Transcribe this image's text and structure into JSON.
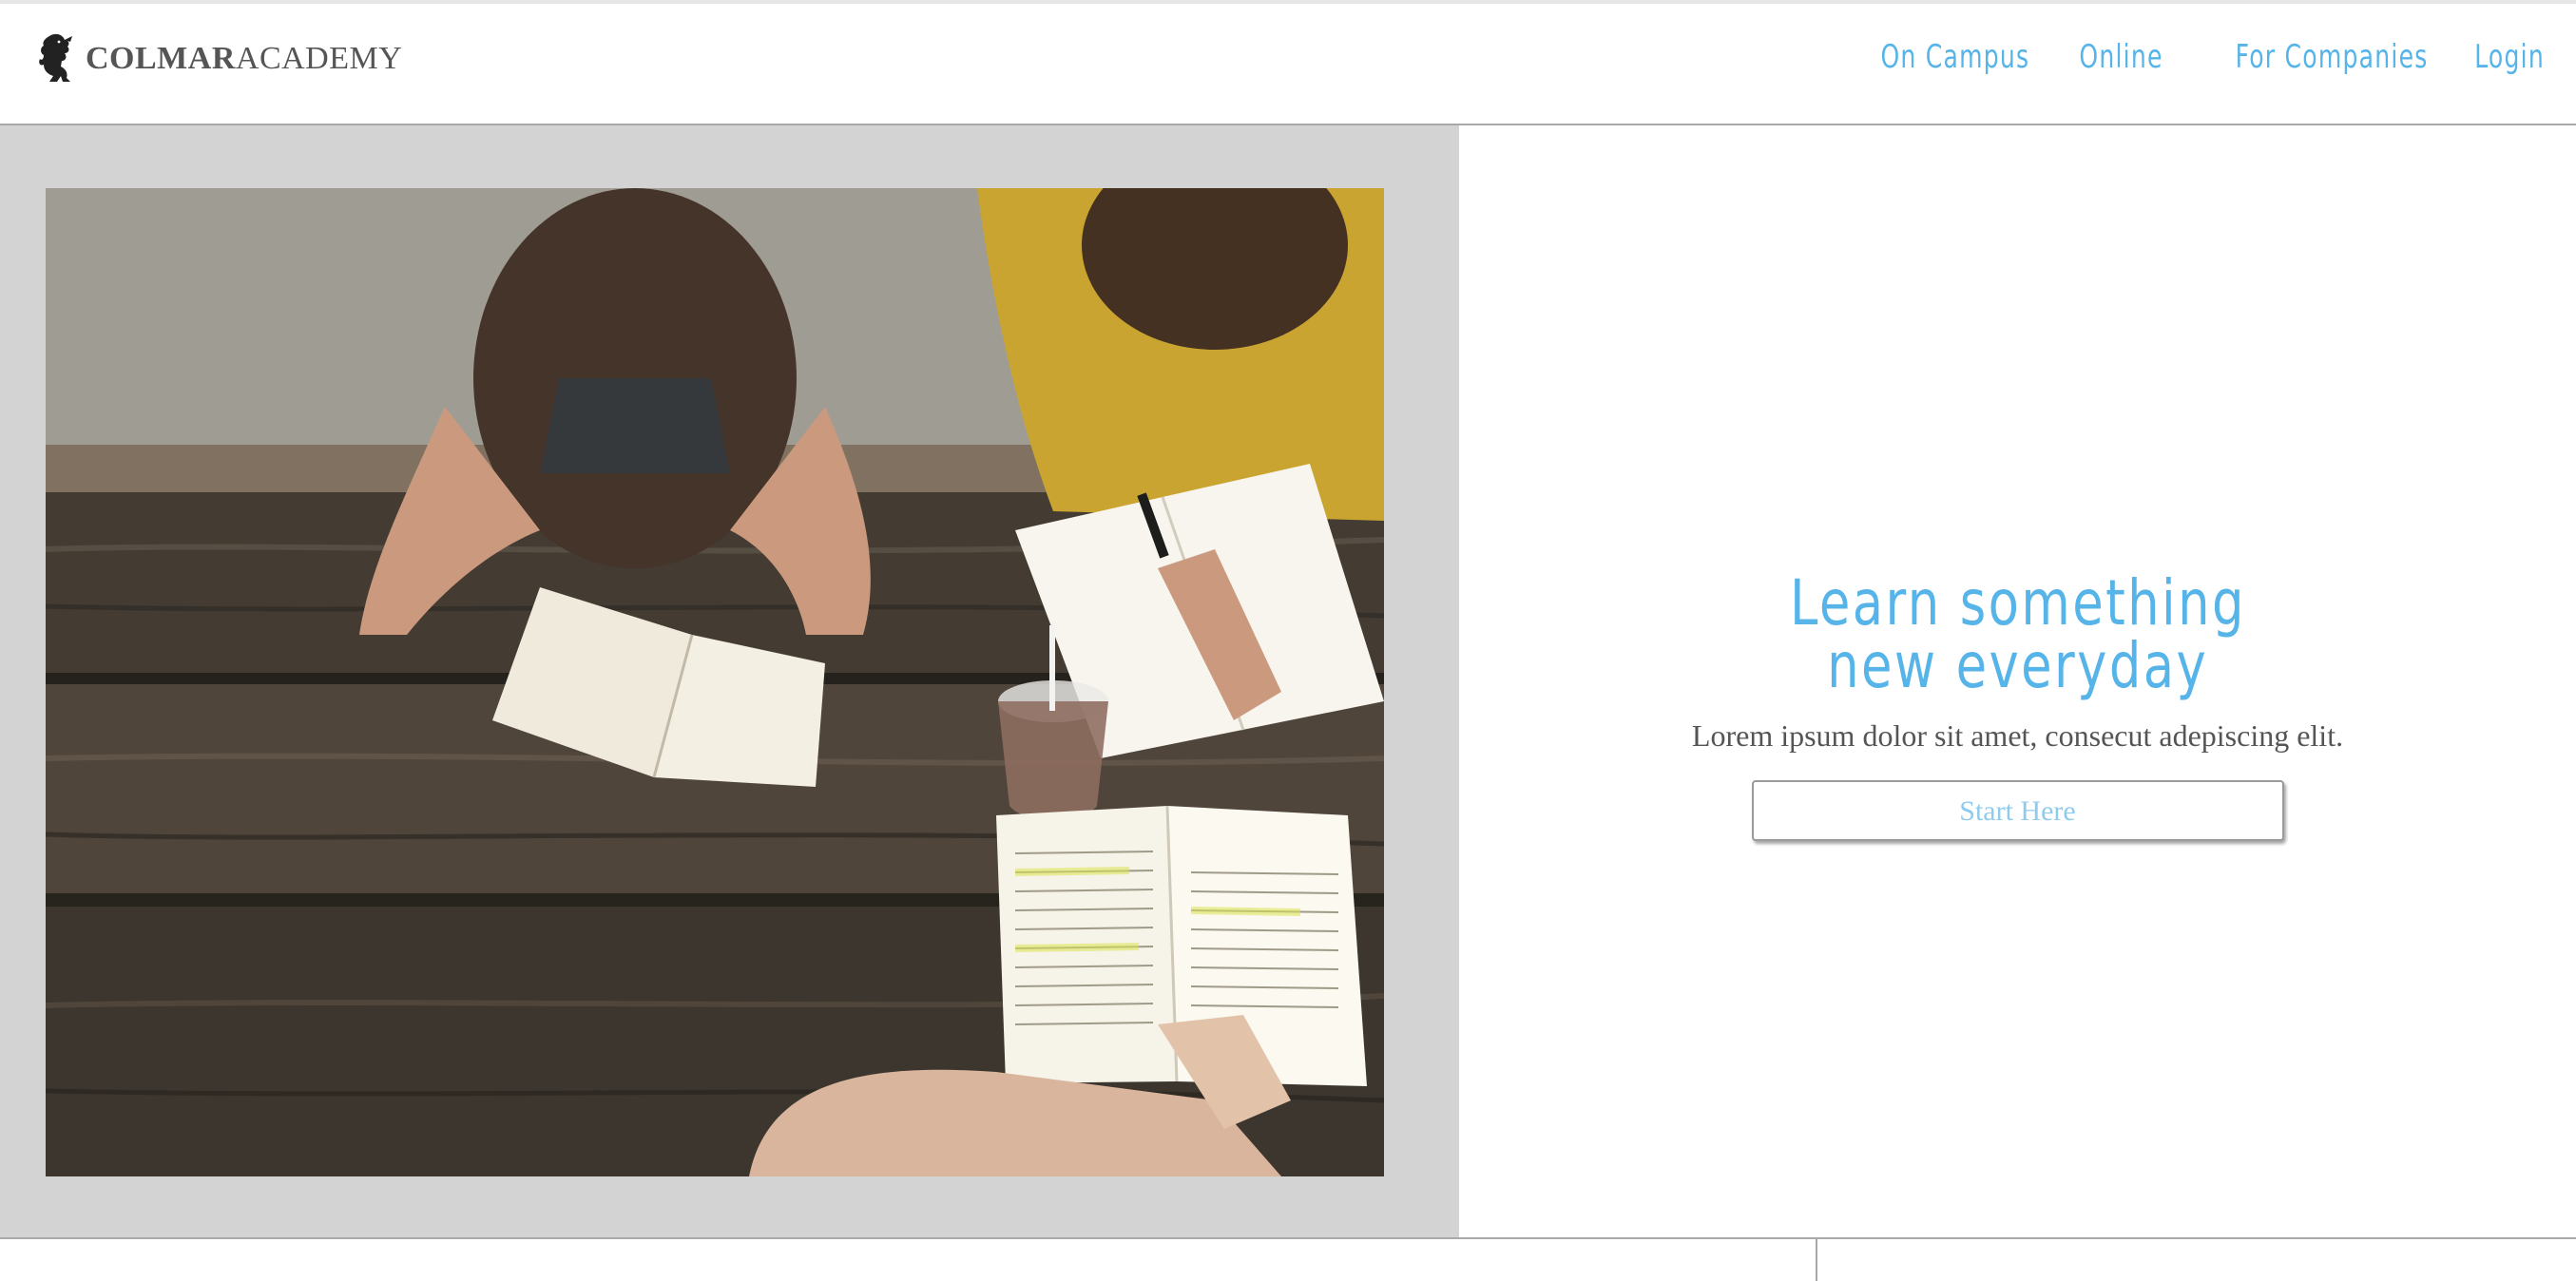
{
  "header": {
    "logo": {
      "bold_text": "COLMAR",
      "light_text": "ACADEMY",
      "icon": "lion-rampant-icon"
    },
    "nav": [
      {
        "label": "On Campus"
      },
      {
        "label": "Online"
      },
      {
        "label": "For Companies"
      },
      {
        "label": "Login"
      }
    ]
  },
  "hero": {
    "image_alt": "",
    "title_line1": "Learn something",
    "title_line2": "new everyday",
    "subtitle": "Lorem ipsum dolor sit amet, consecut adepiscing elit.",
    "button_label": "Start Here"
  },
  "colors": {
    "accent": "#56b4e9",
    "button_text": "#8fcbee",
    "text": "#555555",
    "panel": "#d3d3d3"
  }
}
